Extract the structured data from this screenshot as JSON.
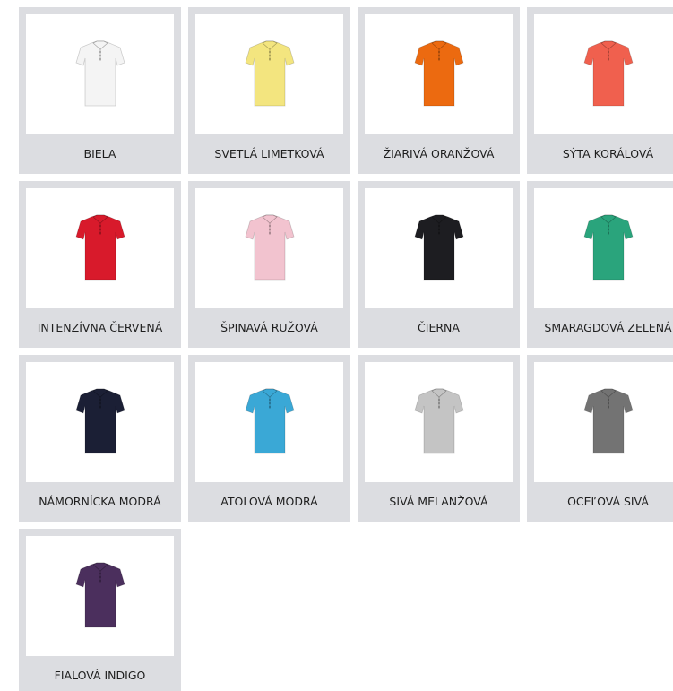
{
  "swatches": [
    {
      "label": "BIELA",
      "color": "#f4f4f4"
    },
    {
      "label": "SVETLÁ LIMETKOVÁ",
      "color": "#f3e57f"
    },
    {
      "label": "ŽIARIVÁ ORANŽOVÁ",
      "color": "#ec6a10"
    },
    {
      "label": "SÝTA KORÁLOVÁ",
      "color": "#f0604e"
    },
    {
      "label": "INTENZÍVNA ČERVENÁ",
      "color": "#d81a2b"
    },
    {
      "label": "ŠPINAVÁ RUŽOVÁ",
      "color": "#f2c3cf"
    },
    {
      "label": "ČIERNA",
      "color": "#1d1d21"
    },
    {
      "label": "SMARAGDOVÁ ZELENÁ",
      "color": "#2aa47c"
    },
    {
      "label": "NÁMORNÍCKA MODRÁ",
      "color": "#1b1f35"
    },
    {
      "label": "ATOLOVÁ MODRÁ",
      "color": "#3aa8d6"
    },
    {
      "label": "SIVÁ MELANŽOVÁ",
      "color": "#c4c4c4"
    },
    {
      "label": "OCEĽOVÁ SIVÁ",
      "color": "#737373"
    },
    {
      "label": "FIALOVÁ INDIGO",
      "color": "#4b2f5d"
    }
  ]
}
